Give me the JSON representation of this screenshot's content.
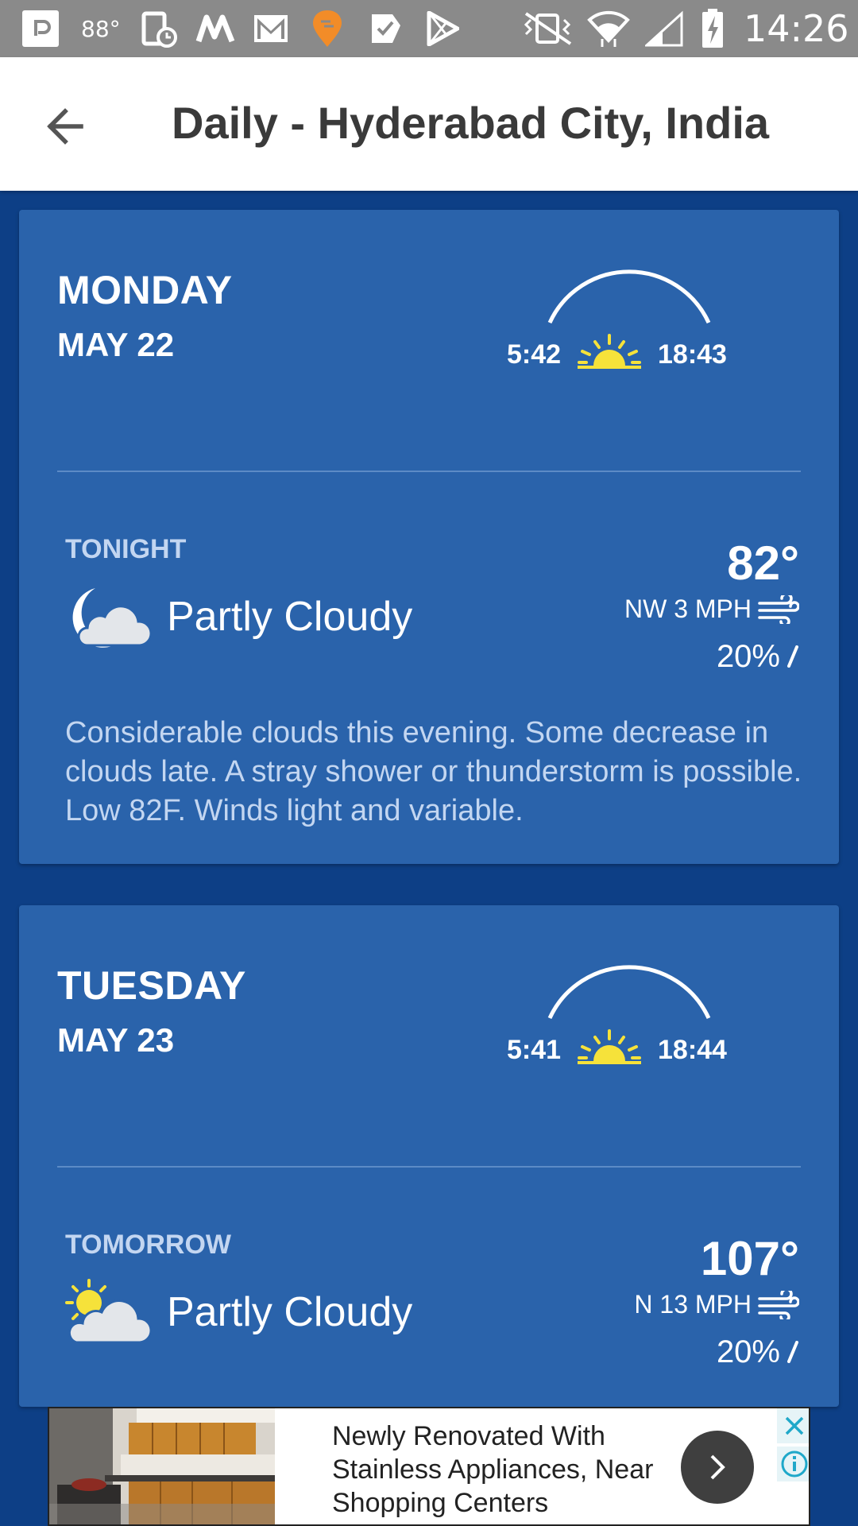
{
  "status_bar": {
    "temperature": "88°",
    "time": "14:26",
    "icons": [
      "notification-square-icon",
      "screen-timer-icon",
      "m-app-icon",
      "gmail-icon",
      "swiggy-icon",
      "tasks-check-icon",
      "play-store-icon",
      "vibrate-icon",
      "wifi-icon",
      "signal-icon",
      "battery-charging-icon"
    ]
  },
  "app_bar": {
    "title": "Daily - Hyderabad City, India"
  },
  "days": [
    {
      "day": "MONDAY",
      "date": "MAY 22",
      "sunrise": "5:42",
      "sunset": "18:43",
      "period": "TONIGHT",
      "condition": "Partly Cloudy",
      "condition_icon": "moon-cloud-icon",
      "temperature": "82°",
      "wind": "NW 3 MPH",
      "precip": "20%",
      "description": "Considerable clouds this evening. Some decrease in clouds late. A stray shower or thunderstorm is possible. Low 82F. Winds light and variable."
    },
    {
      "day": "TUESDAY",
      "date": "MAY 23",
      "sunrise": "5:41",
      "sunset": "18:44",
      "period": "TOMORROW",
      "condition": "Partly Cloudy",
      "condition_icon": "sun-cloud-icon",
      "temperature": "107°",
      "wind": "N 13 MPH",
      "precip": "20%"
    }
  ],
  "ad": {
    "text": "Newly Renovated With Stainless Appliances, Near Shopping Centers"
  },
  "colors": {
    "background": "#0d3f86",
    "card": "#2a63ab",
    "sun": "#f6e23a",
    "label": "#c3d6f1"
  }
}
